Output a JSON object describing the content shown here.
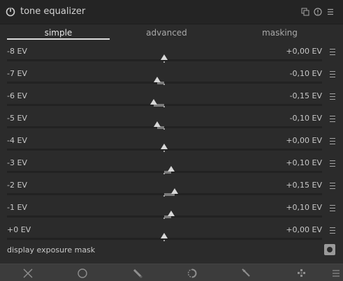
{
  "module": {
    "title": "tone equalizer"
  },
  "tabs": [
    "simple",
    "advanced",
    "masking"
  ],
  "sliders": [
    {
      "label": "-8 EV",
      "value": "+0,00 EV",
      "ev": 0.0
    },
    {
      "label": "-7 EV",
      "value": "-0,10 EV",
      "ev": -0.1
    },
    {
      "label": "-6 EV",
      "value": "-0,15 EV",
      "ev": -0.15
    },
    {
      "label": "-5 EV",
      "value": "-0,10 EV",
      "ev": -0.1
    },
    {
      "label": "-4 EV",
      "value": "+0,00 EV",
      "ev": 0.0
    },
    {
      "label": "-3 EV",
      "value": "+0,10 EV",
      "ev": 0.1
    },
    {
      "label": "-2 EV",
      "value": "+0,15 EV",
      "ev": 0.15
    },
    {
      "label": "-1 EV",
      "value": "+0,10 EV",
      "ev": 0.1
    },
    {
      "label": "+0 EV",
      "value": "+0,00 EV",
      "ev": 0.0
    }
  ],
  "mask": {
    "label": "display exposure mask"
  },
  "colors": {
    "background": "#2b2b2b",
    "header": "#242424",
    "toolbar": "#3c3c3c",
    "accent": "#dcdcdc"
  },
  "icons": {
    "header": [
      "power-icon",
      "presets-icon",
      "reset-icon",
      "menu-icon"
    ],
    "toolbar": [
      "close-icon",
      "circle-icon",
      "pencil-icon",
      "drawing-icon",
      "brush-icon",
      "pattern-icon",
      "more-icon"
    ]
  }
}
